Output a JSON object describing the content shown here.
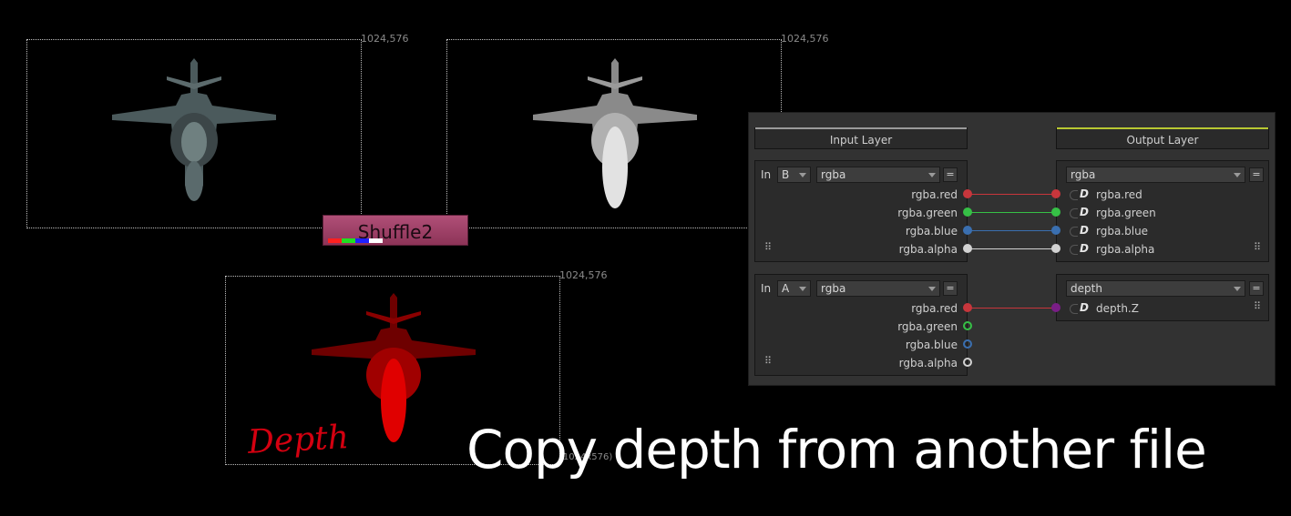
{
  "viewers": {
    "source_res": "1024,576",
    "grey_res": "1024,576",
    "depth_res": "1024,576",
    "depth_bottom_res": "(1024x576)"
  },
  "depth_label": "Depth",
  "node": {
    "name": "Shuffle2",
    "channel_colors": [
      "#ff2020",
      "#20e020",
      "#2020ff",
      "#ffffff"
    ]
  },
  "panel": {
    "input_layer": "Input Layer",
    "output_layer": "Output Layer",
    "group_b": {
      "in_label": "In",
      "input": "B",
      "layer": "rgba",
      "eq": "=",
      "channels": [
        "rgba.red",
        "rgba.green",
        "rgba.blue",
        "rgba.alpha"
      ],
      "out_layer": "rgba",
      "out_eq": "=",
      "out_channels": [
        "rgba.red",
        "rgba.green",
        "rgba.blue",
        "rgba.alpha"
      ]
    },
    "group_a": {
      "in_label": "In",
      "input": "A",
      "layer": "rgba",
      "eq": "=",
      "channels": [
        "rgba.red",
        "rgba.green",
        "rgba.blue",
        "rgba.alpha"
      ],
      "out_layer": "depth",
      "out_eq": "=",
      "out_channels": [
        "depth.Z"
      ]
    },
    "colors": {
      "red": "#c8363c",
      "green": "#36c046",
      "blue": "#3a6fb0",
      "alpha": "#d2d2d2",
      "purple": "#7a1e86",
      "input_accent": "#9a9a9a",
      "output_accent": "#b8c832"
    }
  },
  "caption": "Copy depth from another file"
}
